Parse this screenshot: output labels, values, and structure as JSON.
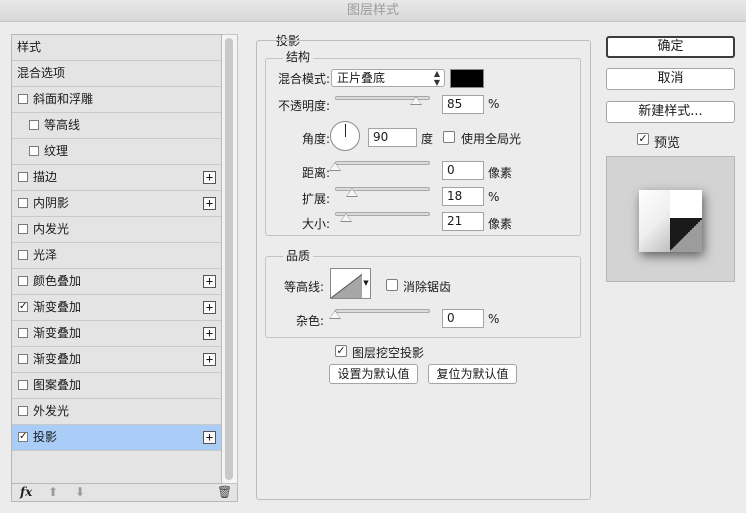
{
  "window": {
    "title": "图层样式"
  },
  "style_list": {
    "items": [
      {
        "label": "样式",
        "checkbox": false,
        "checked": false,
        "plus": false,
        "indent": 0,
        "selected": false
      },
      {
        "label": "混合选项",
        "checkbox": false,
        "checked": false,
        "plus": false,
        "indent": 0,
        "selected": false
      },
      {
        "label": "斜面和浮雕",
        "checkbox": true,
        "checked": false,
        "plus": false,
        "indent": 0,
        "selected": false
      },
      {
        "label": "等高线",
        "checkbox": true,
        "checked": false,
        "plus": false,
        "indent": 1,
        "selected": false
      },
      {
        "label": "纹理",
        "checkbox": true,
        "checked": false,
        "plus": false,
        "indent": 1,
        "selected": false
      },
      {
        "label": "描边",
        "checkbox": true,
        "checked": false,
        "plus": true,
        "indent": 0,
        "selected": false
      },
      {
        "label": "内阴影",
        "checkbox": true,
        "checked": false,
        "plus": true,
        "indent": 0,
        "selected": false
      },
      {
        "label": "内发光",
        "checkbox": true,
        "checked": false,
        "plus": false,
        "indent": 0,
        "selected": false
      },
      {
        "label": "光泽",
        "checkbox": true,
        "checked": false,
        "plus": false,
        "indent": 0,
        "selected": false
      },
      {
        "label": "颜色叠加",
        "checkbox": true,
        "checked": false,
        "plus": true,
        "indent": 0,
        "selected": false
      },
      {
        "label": "渐变叠加",
        "checkbox": true,
        "checked": true,
        "plus": true,
        "indent": 0,
        "selected": false
      },
      {
        "label": "渐变叠加",
        "checkbox": true,
        "checked": false,
        "plus": true,
        "indent": 0,
        "selected": false
      },
      {
        "label": "渐变叠加",
        "checkbox": true,
        "checked": false,
        "plus": true,
        "indent": 0,
        "selected": false
      },
      {
        "label": "图案叠加",
        "checkbox": true,
        "checked": false,
        "plus": false,
        "indent": 0,
        "selected": false
      },
      {
        "label": "外发光",
        "checkbox": true,
        "checked": false,
        "plus": false,
        "indent": 0,
        "selected": false
      },
      {
        "label": "投影",
        "checkbox": true,
        "checked": true,
        "plus": true,
        "indent": 0,
        "selected": true
      }
    ],
    "footer": {
      "fx": "fx",
      "up_icon": "arrow-up-icon",
      "down_icon": "arrow-down-icon",
      "trash_icon": "trash-icon"
    }
  },
  "drop_shadow": {
    "section_title": "投影",
    "structure": {
      "title": "结构",
      "blend_mode_label": "混合模式:",
      "blend_mode_value": "正片叠底",
      "color": "#000000",
      "opacity_label": "不透明度:",
      "opacity_value": "85",
      "opacity_unit": "%",
      "opacity_fraction": 0.85,
      "angle_label": "角度:",
      "angle_value": "90",
      "angle_unit": "度",
      "global_light_label": "使用全局光",
      "global_light_checked": false,
      "distance_label": "距离:",
      "distance_value": "0",
      "distance_unit": "像素",
      "distance_fraction": 0.0,
      "spread_label": "扩展:",
      "spread_value": "18",
      "spread_unit": "%",
      "spread_fraction": 0.18,
      "size_label": "大小:",
      "size_value": "21",
      "size_unit": "像素",
      "size_fraction": 0.12
    },
    "quality": {
      "title": "品质",
      "contour_label": "等高线:",
      "antialias_label": "消除锯齿",
      "antialias_checked": false,
      "noise_label": "杂色:",
      "noise_value": "0",
      "noise_unit": "%",
      "noise_fraction": 0.0
    },
    "knockout_label": "图层挖空投影",
    "knockout_checked": true,
    "make_default_label": "设置为默认值",
    "reset_default_label": "复位为默认值"
  },
  "actions": {
    "ok_label": "确定",
    "cancel_label": "取消",
    "new_style_label": "新建样式...",
    "preview_label": "预览",
    "preview_checked": true
  }
}
